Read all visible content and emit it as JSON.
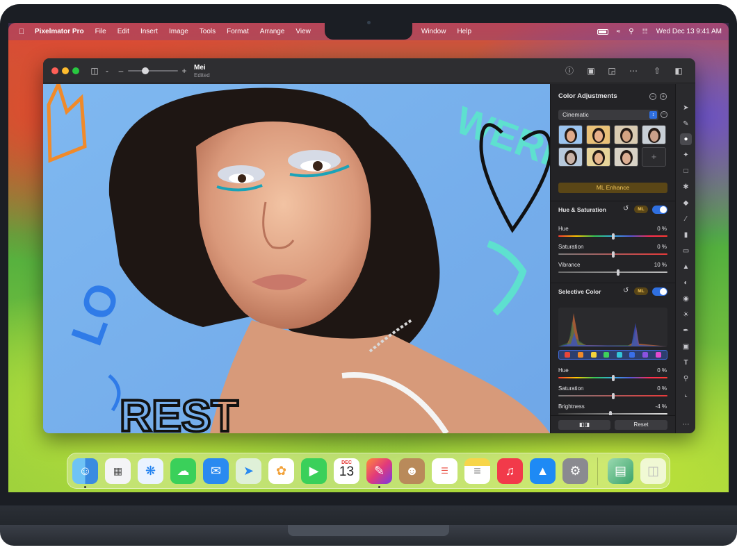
{
  "menubar": {
    "app_name": "Pixelmator Pro",
    "items": [
      "File",
      "Edit",
      "Insert",
      "Image",
      "Tools",
      "Format",
      "Arrange",
      "View",
      "Window",
      "Help"
    ],
    "clock": "Wed Dec 13  9:41 AM"
  },
  "window": {
    "doc_title": "Mei",
    "doc_status": "Edited"
  },
  "panel": {
    "title": "Color Adjustments",
    "preset": "Cinematic",
    "add_preset": "+",
    "ml_enhance": "ML Enhance",
    "ml_badge": "ML",
    "hue_sat": {
      "title": "Hue & Saturation",
      "sliders": [
        {
          "label": "Hue",
          "value": "0 %",
          "level": 0.5
        },
        {
          "label": "Saturation",
          "value": "0 %",
          "level": 0.5
        },
        {
          "label": "Vibrance",
          "value": "10 %",
          "level": 0.55
        }
      ]
    },
    "selective": {
      "title": "Selective Color",
      "swatch_colors": [
        "#e8463a",
        "#f08a2a",
        "#f4d33a",
        "#3ed05a",
        "#34c4d8",
        "#3a6fe8",
        "#8a52e0",
        "#e24ad0"
      ],
      "sliders": [
        {
          "label": "Hue",
          "value": "0 %",
          "level": 0.5
        },
        {
          "label": "Saturation",
          "value": "0 %",
          "level": 0.5
        },
        {
          "label": "Brightness",
          "value": "-4 %",
          "level": 0.48
        }
      ]
    },
    "footer": {
      "compare_label": "◧◨",
      "reset_label": "Reset"
    }
  },
  "dock": {
    "calendar_month": "DEC",
    "calendar_day": "13"
  },
  "canvas_art_text": {
    "rest": "REST",
    "were": "WERE",
    "love": "LO"
  },
  "colors": {
    "accent_blue": "#2f6fe0",
    "ml_gold": "#f1c65a",
    "canvas_sky": "#7eb5ec"
  }
}
